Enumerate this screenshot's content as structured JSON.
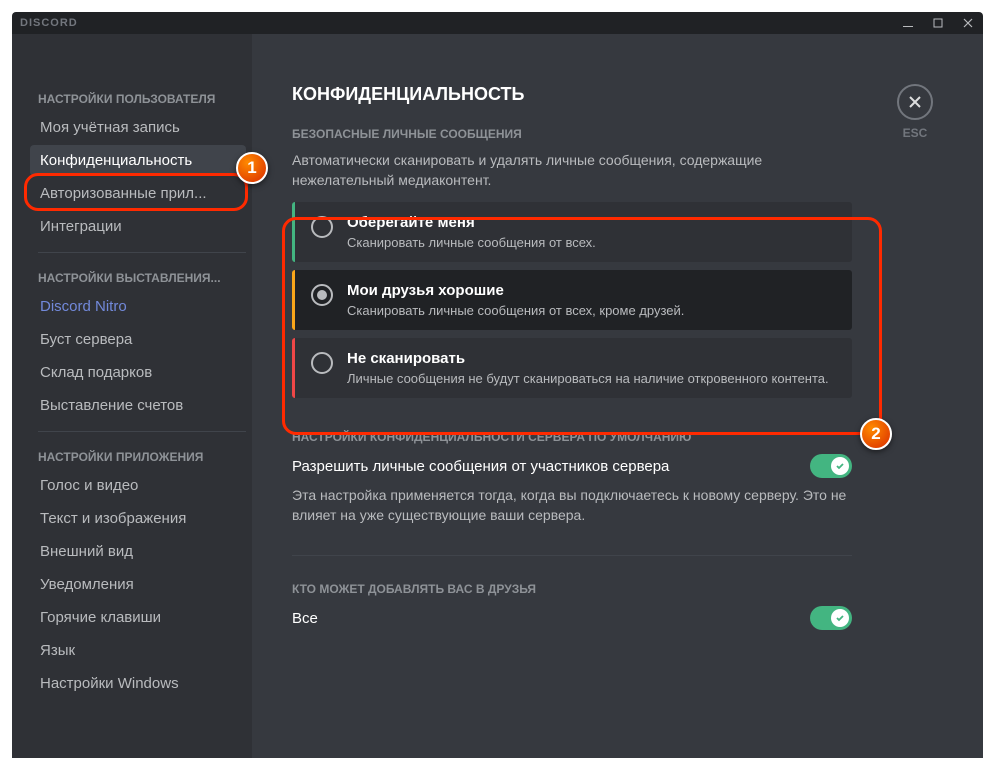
{
  "titlebar": {
    "brand": "DISCORD"
  },
  "closeButton": {
    "label": "ESC"
  },
  "sidebar": {
    "section1": {
      "header": "НАСТРОЙКИ ПОЛЬЗОВАТЕЛЯ",
      "items": [
        "Моя учётная запись",
        "Конфиденциальность",
        "Авторизованные прил...",
        "Интеграции"
      ]
    },
    "section2": {
      "header": "НАСТРОЙКИ ВЫСТАВЛЕНИЯ...",
      "items": [
        "Discord Nitro",
        "Буст сервера",
        "Склад подарков",
        "Выставление счетов"
      ]
    },
    "section3": {
      "header": "НАСТРОЙКИ ПРИЛОЖЕНИЯ",
      "items": [
        "Голос и видео",
        "Текст и изображения",
        "Внешний вид",
        "Уведомления",
        "Горячие клавиши",
        "Язык",
        "Настройки Windows"
      ]
    }
  },
  "content": {
    "title": "КОНФИДЕНЦИАЛЬНОСТЬ",
    "safeDM": {
      "header": "БЕЗОПАСНЫЕ ЛИЧНЫЕ СООБЩЕНИЯ",
      "description": "Автоматически сканировать и удалять личные сообщения, содержащие нежелательный медиаконтент.",
      "options": [
        {
          "title": "Оберегайте меня",
          "desc": "Сканировать личные сообщения от всех."
        },
        {
          "title": "Мои друзья хорошие",
          "desc": "Сканировать личные сообщения от всех, кроме друзей."
        },
        {
          "title": "Не сканировать",
          "desc": "Личные сообщения не будут сканироваться на наличие откровенного контента."
        }
      ]
    },
    "serverPrivacy": {
      "header": "НАСТРОЙКИ КОНФИДЕНЦИАЛЬНОСТИ СЕРВЕРА ПО УМОЛЧАНИЮ",
      "title": "Разрешить личные сообщения от участников сервера",
      "description": "Эта настройка применяется тогда, когда вы подключаетесь к новому серверу. Это не влияет на уже существующие ваши сервера."
    },
    "friends": {
      "header": "КТО МОЖЕТ ДОБАВЛЯТЬ ВАС В ДРУЗЬЯ",
      "title": "Все"
    }
  },
  "markers": {
    "m1": "1",
    "m2": "2"
  }
}
